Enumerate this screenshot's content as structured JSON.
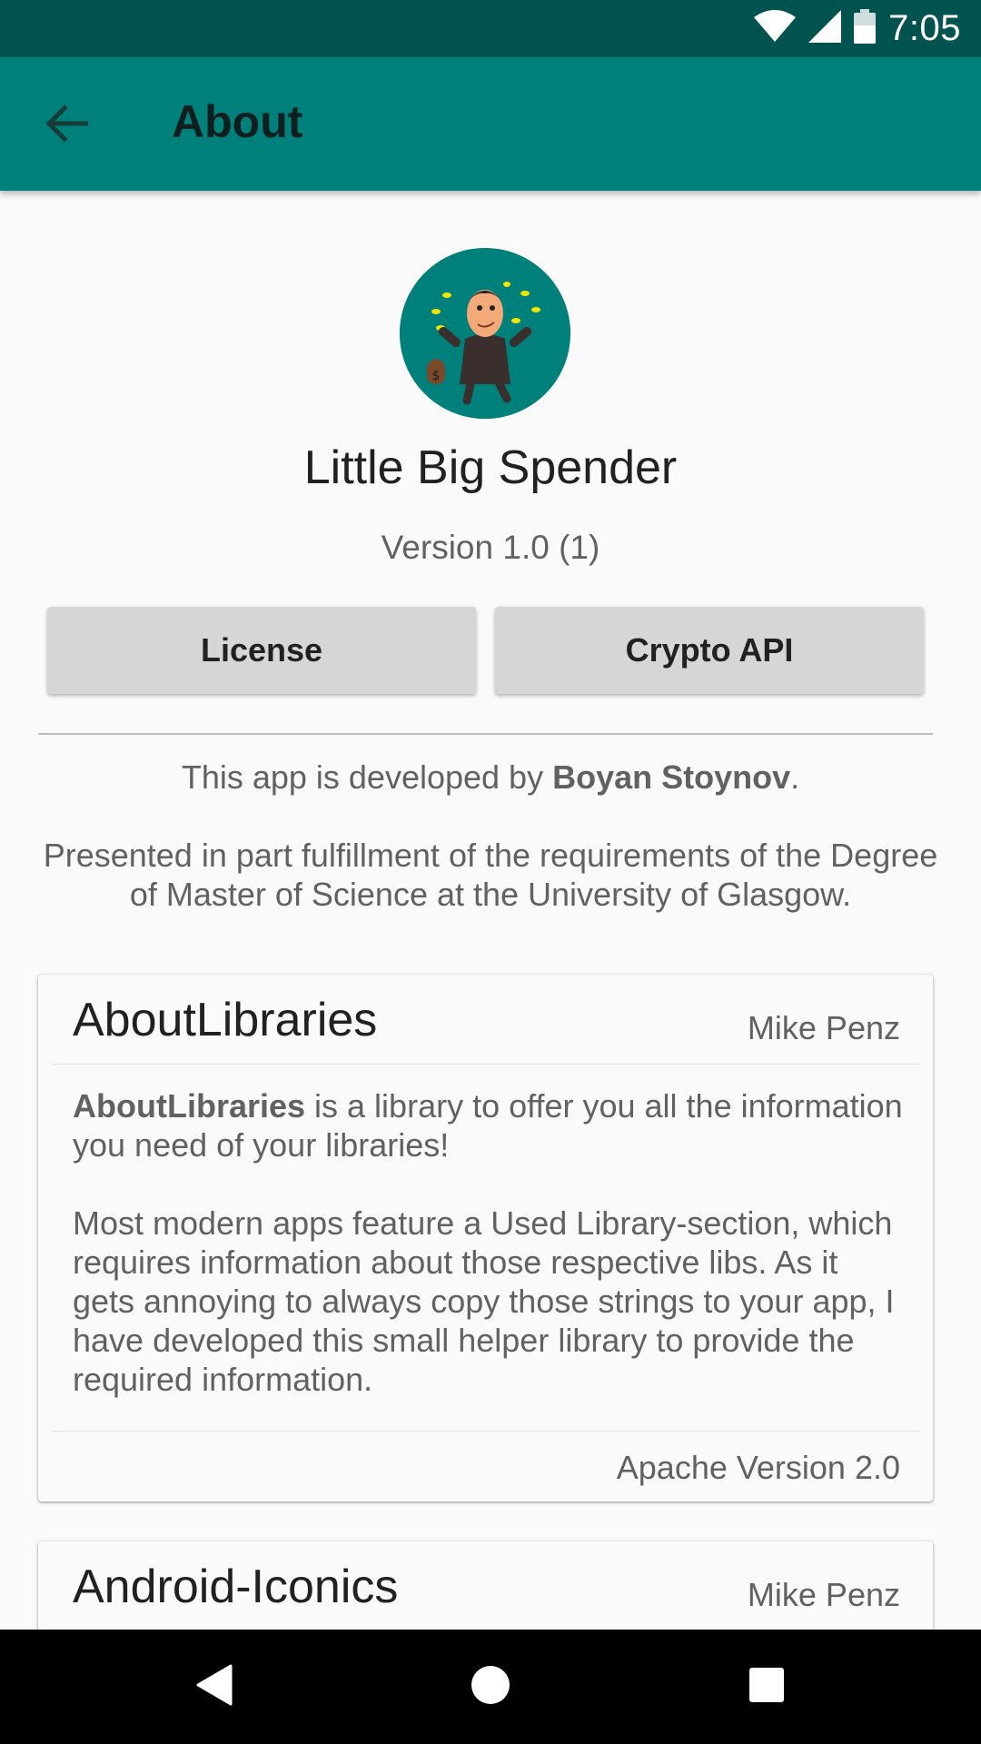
{
  "status_bar": {
    "time": "7:05",
    "icons": [
      "wifi-icon",
      "signal-icon",
      "battery-icon"
    ]
  },
  "app_bar": {
    "back_icon": "arrow-back-icon",
    "title": "About"
  },
  "header": {
    "app_name": "Little Big Spender",
    "version": "Version 1.0 (1)"
  },
  "buttons": {
    "license": "License",
    "crypto_api": "Crypto API"
  },
  "developer": {
    "prefix": "This app is developed by ",
    "name": "Boyan Stoynov",
    "suffix": "."
  },
  "description": "Presented in part fulfillment of the requirements of the Degree of Master of Science at the University of Glasgow.",
  "libraries": [
    {
      "name": "AboutLibraries",
      "author": "Mike Penz",
      "desc_bold": "AboutLibraries",
      "desc_rest": " is a library to offer you all the information you need of your libraries!",
      "desc_para2": "Most modern apps feature a Used Library-section, which requires information about those respective libs. As it gets annoying to always copy those strings to your app, I have developed this small helper library to provide the required information.",
      "license": "Apache Version 2.0"
    },
    {
      "name": "Android-Iconics",
      "author": "Mike Penz"
    }
  ],
  "nav_bar": {
    "icons": [
      "back-triangle-icon",
      "home-circle-icon",
      "recents-square-icon"
    ]
  },
  "colors": {
    "status_bar": "#00534f",
    "app_bar": "#00807a",
    "background": "#fafafa",
    "button": "#d6d6d6"
  }
}
